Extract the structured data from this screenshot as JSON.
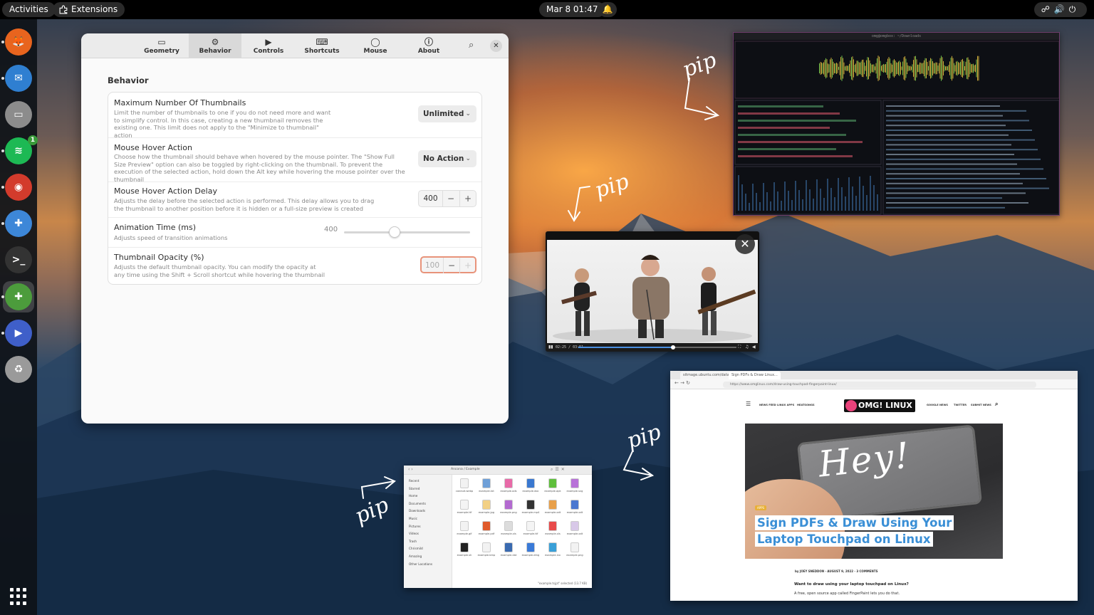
{
  "topbar": {
    "activities": "Activities",
    "extensions": "Extensions",
    "clock": "Mar 8  01:47",
    "bell": "♫",
    "status_icons": "☍🔊⏻"
  },
  "dock": {
    "items": [
      {
        "name": "Firefox",
        "glyph": "🦊",
        "color": "#e8641e"
      },
      {
        "name": "Thunderbird",
        "glyph": "✉",
        "color": "#2f7fd1"
      },
      {
        "name": "Files",
        "glyph": "▭",
        "color": "#8c8c8c"
      },
      {
        "name": "Spotify",
        "glyph": "≋",
        "color": "#1db954",
        "badge": "1"
      },
      {
        "name": "Chrome",
        "glyph": "◉",
        "color": "#d33b2c"
      },
      {
        "name": "Extensions",
        "glyph": "✚",
        "color": "#3d87d8"
      },
      {
        "name": "Terminal",
        "glyph": ">_",
        "color": "#333"
      },
      {
        "name": "Extension Manager",
        "glyph": "✚",
        "color": "#4c9c3c"
      },
      {
        "name": "Video Editor",
        "glyph": "▶",
        "color": "#3f5fc9"
      },
      {
        "name": "Trash",
        "glyph": "♻",
        "color": "#9a9a9a"
      }
    ]
  },
  "prefs": {
    "tabs": [
      {
        "label": "Geometry",
        "icon": "▭"
      },
      {
        "label": "Behavior",
        "icon": "⚙"
      },
      {
        "label": "Controls",
        "icon": "▶"
      },
      {
        "label": "Shortcuts",
        "icon": "⌨"
      },
      {
        "label": "Mouse",
        "icon": "◯"
      },
      {
        "label": "About",
        "icon": "ⓘ"
      }
    ],
    "section_title": "Behavior",
    "rows": {
      "max_thumbs": {
        "title": "Maximum Number Of Thumbnails",
        "desc": "Limit the number of thumbnails to one if you do not need more and want to simplify control. In this case, creating a new thumbnail removes the existing one. This limit does not apply to the \"Minimize to thumbnail\" action",
        "value": "Unlimited"
      },
      "hover_action": {
        "title": "Mouse Hover Action",
        "desc": "Choose how the thumbnail should behave when hovered by the mouse pointer. The \"Show Full Size Preview\" option can also be toggled by right-clicking on the thumbnail. To prevent the execution of the selected action, hold down the Alt key while hovering the mouse pointer over the thumbnail",
        "value": "No Action"
      },
      "hover_delay": {
        "title": "Mouse Hover Action Delay",
        "desc": "Adjusts the delay before the selected action is performed. This delay allows you to drag the thumbnail to another position before it is hidden or a full-size preview is created",
        "value": "400"
      },
      "anim_time": {
        "title": "Animation Time (ms)",
        "desc": "Adjusts speed of transition animations",
        "value": "400",
        "min": 0,
        "max": 1000
      },
      "opacity": {
        "title": "Thumbnail Opacity (%)",
        "desc": "Adjusts the default thumbnail opacity. You can modify the opacity at any time using the Shift + Scroll shortcut while hovering the thumbnail",
        "value": "100"
      }
    }
  },
  "terminal": {
    "title": "omg@omgbox: ~/Downloads"
  },
  "video": {
    "time": "02:25 / 03:51",
    "progress": 0.6
  },
  "browser": {
    "tabs": [
      "sitmage.ubuntu.com/data...",
      "Sign PDFs & Draw Linux..."
    ],
    "url": "https://www.omglinux.com/draw-using-touchpad-fingerpaint-linux/",
    "nav_left": [
      "NEWS FEED",
      "LINUX APPS",
      "HEATSONGS"
    ],
    "nav_right": [
      "GOOGLE NEWS",
      "TWITTER",
      "SUBMIT NEWS"
    ],
    "logo": "OMG! LINUX",
    "hero_word": "Hey!",
    "hero_tag": "APPS",
    "headline": "Sign PDFs & Draw Using Your Laptop Touchpad on Linux",
    "meta": "by JOEY SNEDDON · AUGUST 9, 2022 · 3 COMMENTS",
    "lead": "Want to draw using your laptop touchpad on Linux?",
    "lead2": "A free, open source app called FingerPaint lets you do that."
  },
  "files": {
    "path": "Ancona / Example",
    "places": [
      "Recent",
      "Starred",
      "Home",
      "Documents",
      "Downloads",
      "Music",
      "Pictures",
      "Videos",
      "Trash",
      "Chrismild",
      "Amazing",
      "Other Locations"
    ],
    "items": [
      "conduit.webp",
      "example.txt",
      "example.ods",
      "example.doc",
      "example.apk",
      "example.svg",
      "example.ttf",
      "example.jpg",
      "example.png",
      "example.mp4",
      "example.odt",
      "example.odt",
      "example.gif",
      "example.pdf",
      "example.xls",
      "example.ttf",
      "example.xls",
      "example.odt",
      "example.sh",
      "example.bmp",
      "example.dat",
      "example.dmg",
      "example.ico",
      "example.png"
    ],
    "status": "\"example.tsjpt\" selected (13.7 KB)"
  },
  "annotations": {
    "pip": "pip"
  }
}
